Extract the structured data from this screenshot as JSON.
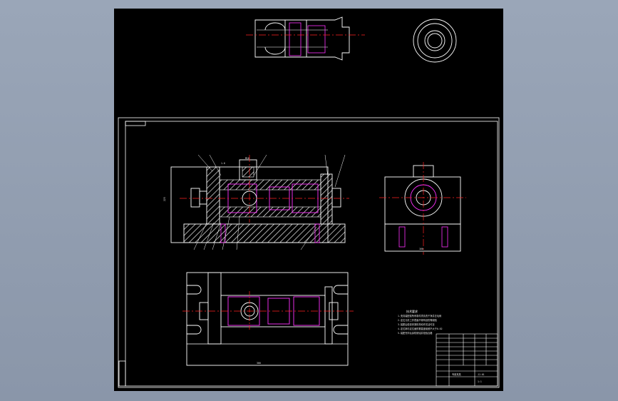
{
  "drawing": {
    "dimension_left": "225",
    "dimension_right": "160",
    "dimension_bottom": "300",
    "label_top": "1.6",
    "label_top2": "M16",
    "tech_title": "技术要求",
    "tech_lines": [
      "1.夹具装配前所有零件须清洗干净并去毛刺",
      "2.定位元件工作表面不得有划伤等缺陷",
      "3.装配后检查夹紧机构动作灵活可靠",
      "4.定位销与定位面的垂直度误差不大于0.02",
      "5.装配完毕后涂防锈油并检验合格"
    ],
    "title_block": {
      "name": "专用夹具",
      "drawing_no": "JJ-01",
      "scale": "1:1"
    }
  },
  "colors": {
    "line": "#ffffff",
    "center": "#ff2020",
    "hidden": "#ff30ff",
    "hatch": "#ffffff"
  }
}
